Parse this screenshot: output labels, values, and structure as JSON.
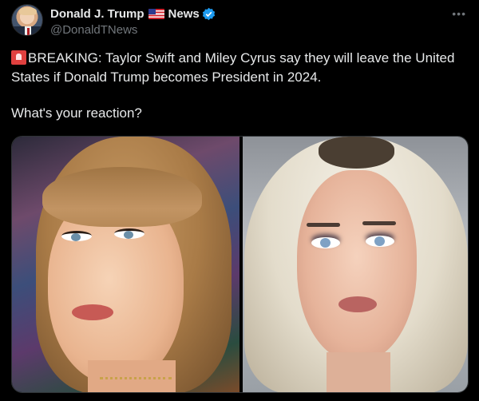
{
  "post": {
    "display_name": "Donald J. Trump",
    "name_suffix": "News",
    "handle": "@DonaldTNews",
    "more_label": "•••",
    "text_line": "BREAKING: Taylor Swift and Miley Cyrus say they will leave the United States if Donald Trump becomes President in 2024.",
    "reaction": "What's your reaction?"
  },
  "icons": {
    "flag": "us-flag-icon",
    "verified": "verified-badge-icon",
    "siren": "siren-icon"
  },
  "colors": {
    "background": "#000000",
    "text": "#e7e9ea",
    "muted": "#71767b",
    "verified": "#1d9bf0"
  }
}
